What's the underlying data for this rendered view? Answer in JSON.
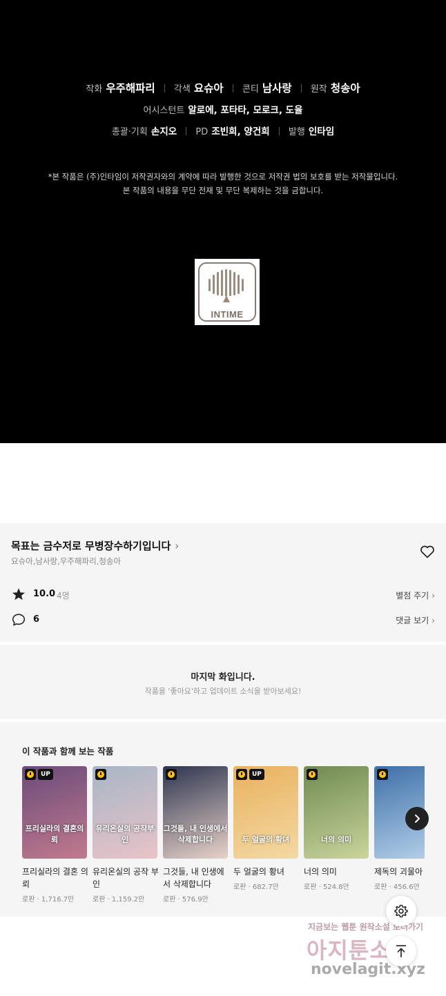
{
  "credits": {
    "line1": [
      {
        "role": "작화",
        "name": "우주해파리"
      },
      {
        "role": "각색",
        "name": "요슈아"
      },
      {
        "role": "콘티",
        "name": "남사랑"
      },
      {
        "role": "원작",
        "name": "청송아"
      }
    ],
    "line2": {
      "role": "어시스턴트",
      "name": "알로에, 포타타, 모로크, 도율"
    },
    "line3": [
      {
        "role": "총괄·기획",
        "name": "손지오"
      },
      {
        "role": "PD",
        "name": "조빈희, 양건희"
      },
      {
        "role": "발행",
        "name": "인타임"
      }
    ],
    "notice1": "*본 작품은 (주)인타임이 저작권자와의 계약에 따라 발행한 것으로 저작권 법의 보호를 받는 저작물입니다.",
    "notice2": "본 작품의 내용을 무단 전재 및 무단 복제하는 것을 금합니다.",
    "logo_text": "INTIME"
  },
  "work": {
    "title": "목표는 금수저로 무병장수하기입니다",
    "title_chevron": "›",
    "authors": "요슈아,남사랑,우주해파리,청송아",
    "rating": "10.0",
    "rating_count": "4명",
    "rate_link": "별점 주기",
    "comment_count": "6",
    "comment_link": "댓글 보기",
    "chevron": "›"
  },
  "last_episode": {
    "title": "마지막 화입니다.",
    "subtitle": "작품을 '좋아요'하고 업데이트 소식을 받아보세요!"
  },
  "recommend": {
    "title": "이 작품과 함께 보는 작품",
    "items": [
      {
        "title": "프리실라의 결혼 의뢰",
        "meta": "로판 · 1,716.7만",
        "up": "UP",
        "cover_text": "프리실라의 결혼의뢰",
        "colors": [
          "#6a4b7a",
          "#c27a8e"
        ]
      },
      {
        "title": "유리온실의 공작 부인",
        "meta": "로판 · 1,159.2만",
        "up": "",
        "cover_text": "유리온실의 공작부인",
        "colors": [
          "#a7b6c6",
          "#e9c3c8"
        ]
      },
      {
        "title": "그것들, 내 인생에서 삭제합니다",
        "meta": "로판 · 576.9만",
        "up": "",
        "cover_text": "그것들, 내 인생에서 삭제합니다",
        "colors": [
          "#2d3550",
          "#e8d2c9"
        ]
      },
      {
        "title": "두 얼굴의 황녀",
        "meta": "로판 · 682.7만",
        "up": "UP",
        "cover_text": "두 얼굴의 황녀",
        "colors": [
          "#e9b15e",
          "#f3d9a3"
        ]
      },
      {
        "title": "너의 의미",
        "meta": "로판 · 524.8만",
        "up": "",
        "cover_text": "너의 의미",
        "colors": [
          "#6f8a52",
          "#c9d59b"
        ]
      },
      {
        "title": "제독의 괴물아",
        "meta": "로판 · 456.6만",
        "up": "",
        "cover_text": "",
        "colors": [
          "#3d6fa8",
          "#b7d2ea"
        ]
      }
    ]
  },
  "watermark": {
    "line1": "지금보는 웹툰 원작소설 보러가기",
    "line2": "아지툰소설",
    "line3": "novelagit.xyz"
  },
  "icons": {
    "heart": "heart-icon",
    "star": "star-icon",
    "comment": "comment-icon",
    "settings": "gear-icon",
    "top": "arrow-up-icon",
    "next": "chevron-right-icon"
  }
}
